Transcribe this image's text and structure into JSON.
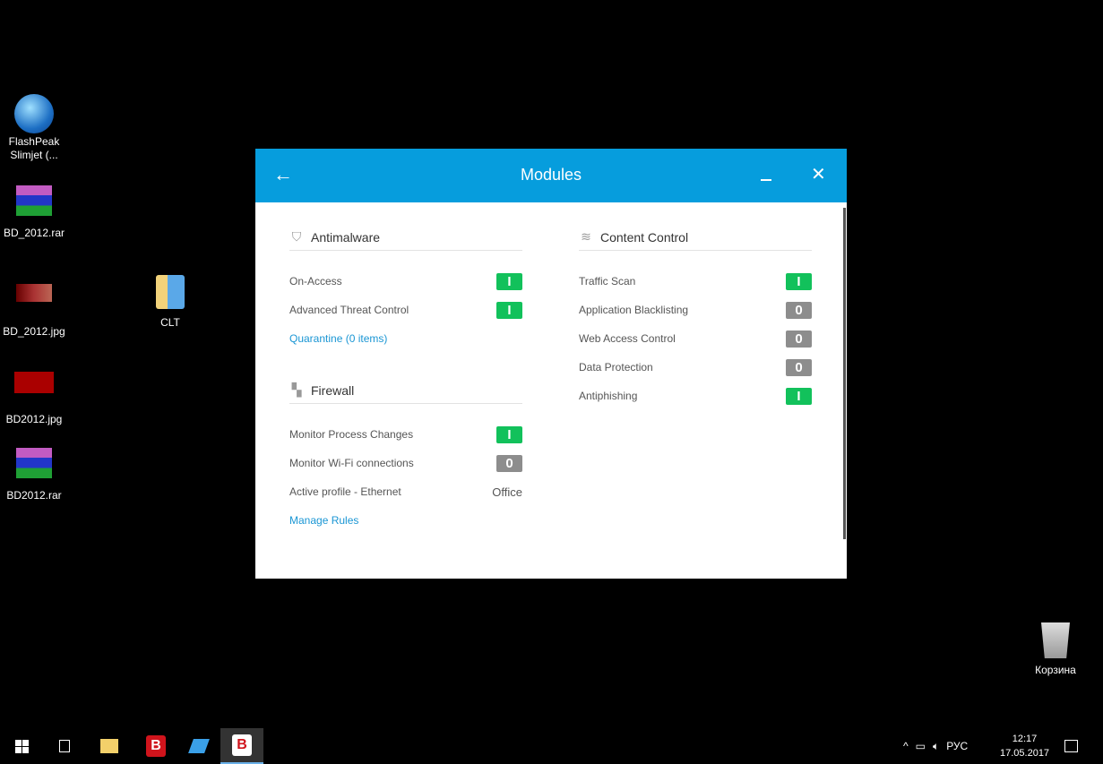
{
  "desktop": {
    "icons": [
      {
        "label": "FlashPeak Slimjet (...",
        "icon": "globe-shortcut"
      },
      {
        "label": "BD_2012.rar",
        "icon": "winrar-archive"
      },
      {
        "label": "BD_2012.jpg",
        "icon": "image-file"
      },
      {
        "label": "BD2012.jpg",
        "icon": "image-file"
      },
      {
        "label": "BD2012.rar",
        "icon": "winrar-archive"
      },
      {
        "label": "CLT",
        "icon": "folder"
      },
      {
        "label": "Корзина",
        "icon": "recycle-bin"
      }
    ]
  },
  "dialog": {
    "title": "Modules",
    "back": "←",
    "close": "✕",
    "antimalware": {
      "title": "Antimalware",
      "rows": [
        {
          "label": "On-Access",
          "state": "I"
        },
        {
          "label": "Advanced Threat Control",
          "state": "I"
        }
      ],
      "link": "Quarantine (0 items)"
    },
    "firewall": {
      "title": "Firewall",
      "rows": [
        {
          "label": "Monitor Process Changes",
          "state": "I"
        },
        {
          "label": "Monitor Wi-Fi connections",
          "state": "0"
        }
      ],
      "profile_label": "Active profile - Ethernet",
      "profile_value": "Office",
      "link": "Manage Rules"
    },
    "content": {
      "title": "Content Control",
      "rows": [
        {
          "label": "Traffic Scan",
          "state": "I"
        },
        {
          "label": "Application Blacklisting",
          "state": "0"
        },
        {
          "label": "Web Access Control",
          "state": "0"
        },
        {
          "label": "Data Protection",
          "state": "0"
        },
        {
          "label": "Antiphishing",
          "state": "I"
        }
      ]
    }
  },
  "taskbar": {
    "lang": "РУС",
    "time": "12:17",
    "date": "17.05.2017",
    "app_letter": "B"
  },
  "colors": {
    "accent": "#069ddd",
    "on": "#12c15b",
    "off": "#8d8d8d",
    "link": "#1a96d4"
  }
}
